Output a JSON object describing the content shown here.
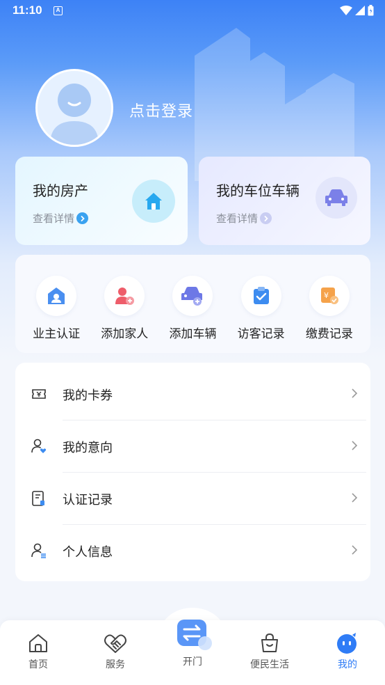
{
  "status_bar": {
    "time": "11:10",
    "indicator": "A"
  },
  "profile": {
    "login_label": "点击登录"
  },
  "assets": {
    "house": {
      "title": "我的房产",
      "more": "查看详情"
    },
    "car": {
      "title": "我的车位车辆",
      "more": "查看详情"
    }
  },
  "quick_actions": [
    {
      "label": "业主认证",
      "icon": "owner-verify-icon"
    },
    {
      "label": "添加家人",
      "icon": "add-family-icon"
    },
    {
      "label": "添加车辆",
      "icon": "add-vehicle-icon"
    },
    {
      "label": "访客记录",
      "icon": "visitor-record-icon"
    },
    {
      "label": "缴费记录",
      "icon": "payment-record-icon"
    }
  ],
  "menu": [
    {
      "label": "我的卡券",
      "icon": "coupon-icon"
    },
    {
      "label": "我的意向",
      "icon": "intention-icon"
    },
    {
      "label": "认证记录",
      "icon": "certification-record-icon"
    },
    {
      "label": "个人信息",
      "icon": "personal-info-icon"
    }
  ],
  "tabs": [
    {
      "label": "首页",
      "icon": "home-icon"
    },
    {
      "label": "服务",
      "icon": "handshake-icon"
    },
    {
      "label": "开门",
      "icon": "door-open-icon"
    },
    {
      "label": "便民生活",
      "icon": "shopping-bag-icon"
    },
    {
      "label": "我的",
      "icon": "profile-face-icon",
      "active": true
    }
  ],
  "colors": {
    "accent": "#2f7cf6",
    "header_blue": "#3d82f6"
  }
}
